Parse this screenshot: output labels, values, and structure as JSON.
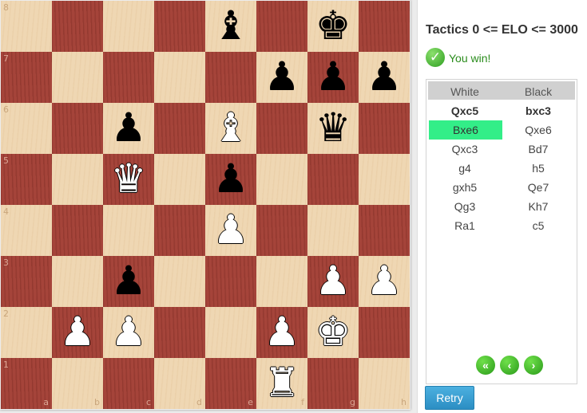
{
  "header": {
    "title": "Tactics 0 <= ELO <= 3000"
  },
  "status": {
    "icon": "check-circle-icon",
    "text": "You win!"
  },
  "moves": {
    "columns": {
      "white": "White",
      "black": "Black"
    },
    "rows": [
      {
        "white": "Qxc5",
        "black": "bxc3",
        "bold": true
      },
      {
        "white": "Bxe6",
        "black": "Qxe6",
        "white_active": true
      },
      {
        "white": "Qxc3",
        "black": "Bd7"
      },
      {
        "white": "g4",
        "black": "h5"
      },
      {
        "white": "gxh5",
        "black": "Qe7"
      },
      {
        "white": "Qg3",
        "black": "Kh7"
      },
      {
        "white": "Ra1",
        "black": "c5"
      }
    ]
  },
  "navigation": {
    "first": "double-chevron-left-icon",
    "prev": "chevron-left-icon",
    "next": "chevron-right-icon"
  },
  "retry_label": "Retry",
  "board": {
    "light_color": "#efd7b3",
    "dark_color": "#a5443a",
    "rank_labels": [
      "8",
      "7",
      "6",
      "5",
      "4",
      "3",
      "2",
      "1"
    ],
    "file_labels": [
      "a",
      "b",
      "c",
      "d",
      "e",
      "f",
      "g",
      "h"
    ],
    "pieces": [
      {
        "square": "e8",
        "color": "b",
        "type": "bishop"
      },
      {
        "square": "g8",
        "color": "b",
        "type": "king"
      },
      {
        "square": "f7",
        "color": "b",
        "type": "pawn"
      },
      {
        "square": "g7",
        "color": "b",
        "type": "pawn"
      },
      {
        "square": "h7",
        "color": "b",
        "type": "pawn"
      },
      {
        "square": "c6",
        "color": "b",
        "type": "pawn"
      },
      {
        "square": "e6",
        "color": "w",
        "type": "bishop"
      },
      {
        "square": "g6",
        "color": "b",
        "type": "queen"
      },
      {
        "square": "c5",
        "color": "w",
        "type": "queen"
      },
      {
        "square": "e5",
        "color": "b",
        "type": "pawn"
      },
      {
        "square": "e4",
        "color": "w",
        "type": "pawn"
      },
      {
        "square": "c3",
        "color": "b",
        "type": "pawn"
      },
      {
        "square": "g3",
        "color": "w",
        "type": "pawn"
      },
      {
        "square": "h3",
        "color": "w",
        "type": "pawn"
      },
      {
        "square": "b2",
        "color": "w",
        "type": "pawn"
      },
      {
        "square": "c2",
        "color": "w",
        "type": "pawn"
      },
      {
        "square": "f2",
        "color": "w",
        "type": "pawn"
      },
      {
        "square": "g2",
        "color": "w",
        "type": "king"
      },
      {
        "square": "f1",
        "color": "w",
        "type": "rook"
      }
    ]
  }
}
